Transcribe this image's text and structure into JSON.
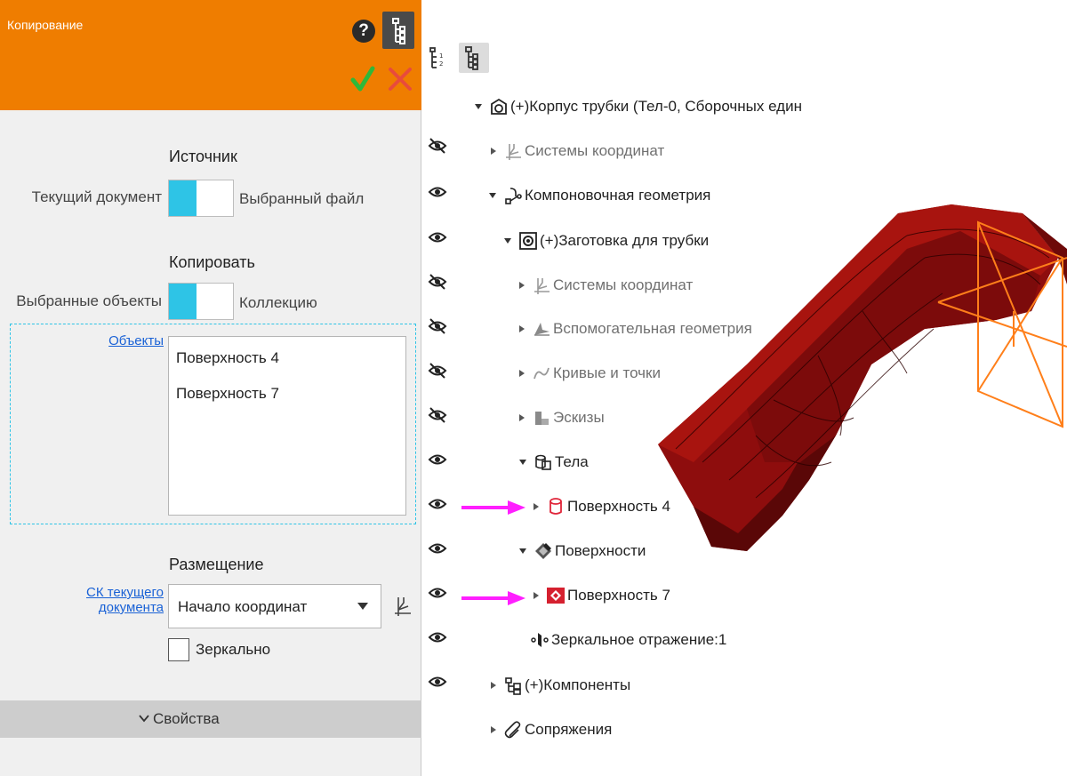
{
  "dialog": {
    "title": "Копирование",
    "help_glyph": "?",
    "source": {
      "heading": "Источник",
      "left_option": "Текущий документ",
      "right_option": "Выбранный файл"
    },
    "copy": {
      "heading": "Копировать",
      "left_option": "Выбранные объекты",
      "right_option": "Коллекцию"
    },
    "objects_link": "Объекты",
    "objects": [
      "Поверхность 4",
      "Поверхность 7"
    ],
    "placement": {
      "heading": "Размещение",
      "cs_link_line1": "СК текущего",
      "cs_link_line2": "документа",
      "selected_value": "Начало координат",
      "mirror_label": "Зеркально",
      "mirror_checked": false
    },
    "properties_label": "Свойства",
    "colors": {
      "header": "#ef7d00",
      "switch_accent": "#2ec4e6",
      "ok": "#2fb83a",
      "cancel": "#e84b3c"
    }
  },
  "tree": {
    "root": "(+)Корпус трубки (Тел-0, Сборочных един",
    "items": [
      {
        "label": "Системы координат"
      },
      {
        "label": "Компоновочная геометрия"
      },
      {
        "label": "(+)Заготовка для трубки"
      },
      {
        "label": "Системы координат"
      },
      {
        "label": "Вспомогательная геометрия"
      },
      {
        "label": "Кривые и точки"
      },
      {
        "label": "Эскизы"
      },
      {
        "label": "Тела"
      },
      {
        "label": "Поверхность 4"
      },
      {
        "label": "Поверхности"
      },
      {
        "label": "Поверхность 7"
      },
      {
        "label": "Зеркальное отражение:1"
      },
      {
        "label": "(+)Компоненты"
      },
      {
        "label": "Сопряжения"
      }
    ],
    "highlight_arrow_color": "#ff1fff"
  }
}
